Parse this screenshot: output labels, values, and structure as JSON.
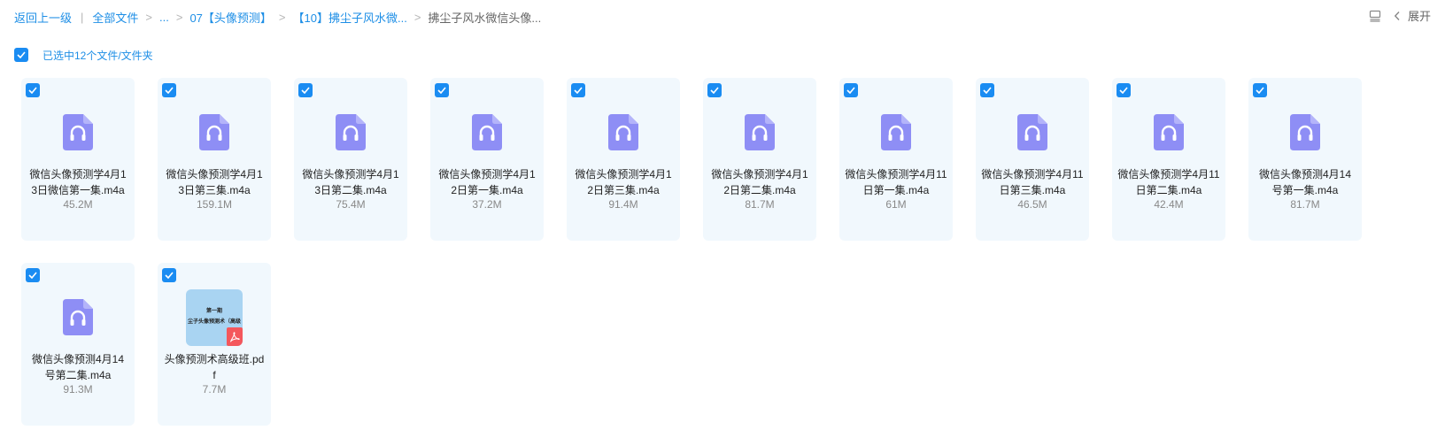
{
  "breadcrumb": {
    "back": "返回上一级",
    "all_files": "全部文件",
    "ellipsis": "...",
    "folder1": "07【头像预测】",
    "folder2": "【10】拂尘子风水微...",
    "current": "拂尘子风水微信头像..."
  },
  "toolbar": {
    "expand_label": "展开"
  },
  "selection": {
    "text": "已选中12个文件/文件夹"
  },
  "colors": {
    "accent": "#1a8cf2",
    "card_bg": "#f1f8fd",
    "audio_icon": "#8e8ef5",
    "pdf_red": "#f4575c"
  },
  "files": [
    {
      "name": "微信头像预测学4月13日微信第一集.m4a",
      "size": "45.2M",
      "icon": "audio-file-icon",
      "checked": true
    },
    {
      "name": "微信头像预测学4月13日第三集.m4a",
      "size": "159.1M",
      "icon": "audio-file-icon",
      "checked": true
    },
    {
      "name": "微信头像预测学4月13日第二集.m4a",
      "size": "75.4M",
      "icon": "audio-file-icon",
      "checked": true
    },
    {
      "name": "微信头像预测学4月12日第一集.m4a",
      "size": "37.2M",
      "icon": "audio-file-icon",
      "checked": true
    },
    {
      "name": "微信头像预测学4月12日第三集.m4a",
      "size": "91.4M",
      "icon": "audio-file-icon",
      "checked": true
    },
    {
      "name": "微信头像预测学4月12日第二集.m4a",
      "size": "81.7M",
      "icon": "audio-file-icon",
      "checked": true
    },
    {
      "name": "微信头像预测学4月11日第一集.m4a",
      "size": "61M",
      "icon": "audio-file-icon",
      "checked": true
    },
    {
      "name": "微信头像预测学4月11日第三集.m4a",
      "size": "46.5M",
      "icon": "audio-file-icon",
      "checked": true
    },
    {
      "name": "微信头像预测学4月11日第二集.m4a",
      "size": "42.4M",
      "icon": "audio-file-icon",
      "checked": true
    },
    {
      "name": "微信头像预测4月14号第一集.m4a",
      "size": "81.7M",
      "icon": "audio-file-icon",
      "checked": true
    },
    {
      "name": "微信头像预测4月14号第二集.m4a",
      "size": "91.3M",
      "icon": "audio-file-icon",
      "checked": true
    },
    {
      "name": "头像预测术高级班.pdf",
      "size": "7.7M",
      "icon": "pdf-thumbnail",
      "checked": true,
      "thumb_line1": "第一期",
      "thumb_line2": "尘子头像预测术（高级"
    }
  ]
}
